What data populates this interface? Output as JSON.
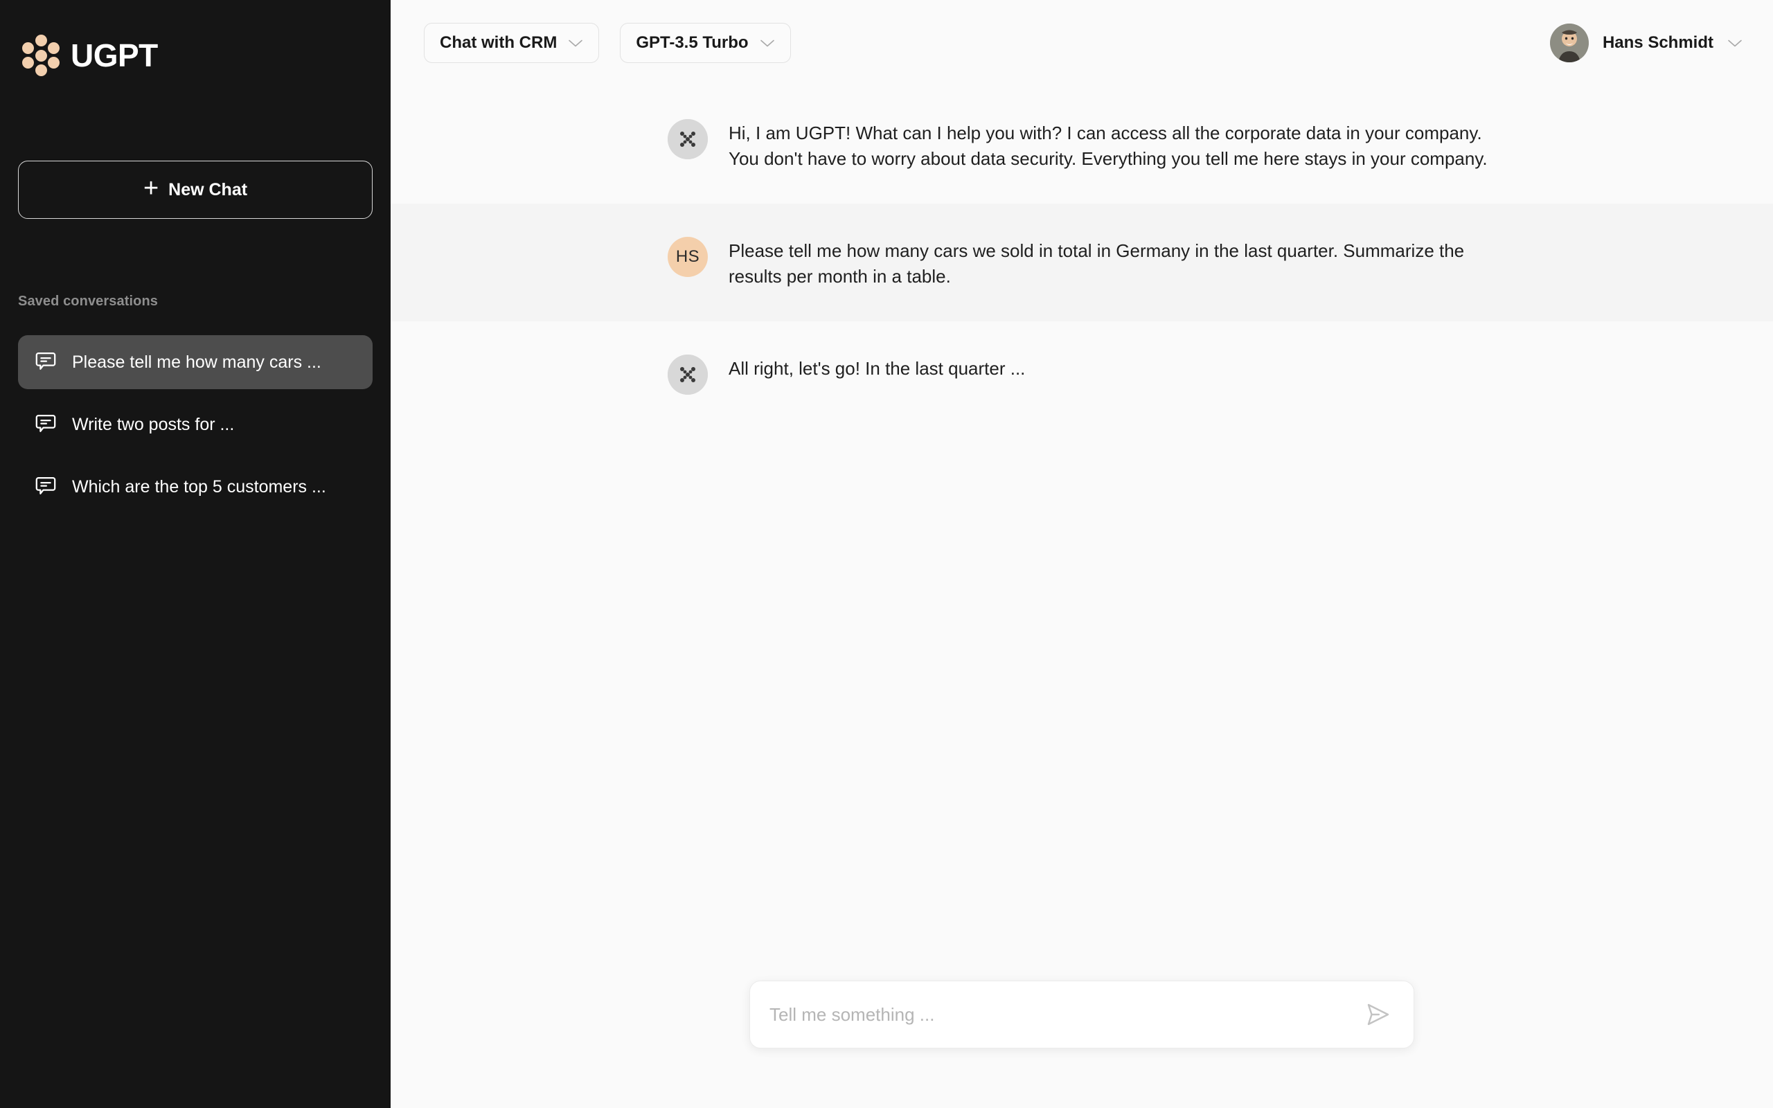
{
  "brand": {
    "name": "UGPT",
    "logo_icon": "ugpt-dots-logo",
    "dot_color": "#f2cfae"
  },
  "sidebar": {
    "new_chat": {
      "label": "New Chat",
      "icon": "plus-icon"
    },
    "saved_label": "Saved conversations",
    "conversations": [
      {
        "label": "Please tell me how many cars ...",
        "icon": "chat-bubble-icon",
        "active": true
      },
      {
        "label": "Write two posts for ...",
        "icon": "chat-bubble-icon",
        "active": false
      },
      {
        "label": "Which are the top 5 customers ...",
        "icon": "chat-bubble-icon",
        "active": false
      }
    ]
  },
  "topbar": {
    "source_selector": {
      "label": "Chat with CRM",
      "icon": "chevron-down-icon"
    },
    "model_selector": {
      "label": "GPT-3.5 Turbo",
      "icon": "chevron-down-icon"
    },
    "user": {
      "name": "Hans Schmidt",
      "avatar": "user-photo-avatar",
      "icon": "chevron-down-icon"
    }
  },
  "messages": [
    {
      "role": "bot",
      "avatar_type": "bot-logo-avatar",
      "text": "Hi, I am UGPT! What can I help you with? I can access all the corporate data in your company. You don't have to worry about data security. Everything you tell me here stays in your company."
    },
    {
      "role": "user",
      "avatar_type": "initials-avatar",
      "initials": "HS",
      "text": "Please tell me how many cars we sold in total in Germany in the last quarter. Summarize the results per month in a table."
    },
    {
      "role": "bot",
      "avatar_type": "bot-logo-avatar",
      "text": "All right, let's go! In the last quarter ..."
    }
  ],
  "composer": {
    "placeholder": "Tell me something ...",
    "value": "",
    "send_icon": "send-paper-plane-icon"
  },
  "colors": {
    "sidebar_bg": "#151515",
    "main_bg": "#fafafa",
    "user_row_bg": "#f4f4f4",
    "accent_peach": "#f2cfae",
    "active_item_bg": "#4d4d4d"
  }
}
